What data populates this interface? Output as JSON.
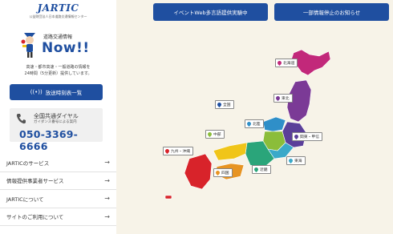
{
  "sidebar": {
    "logo": {
      "main": "JARTIC",
      "sub": "公益財団法人日本道路交通情報センター"
    },
    "hero": {
      "title": "道路交通情報",
      "brand": "Now!!"
    },
    "description": [
      "高速・都市高速・一般道路の情報を",
      "24時間（5分更新）提供しています。"
    ],
    "schedule_button": {
      "label": "放送時刻表一覧"
    },
    "phone": {
      "line1": "全国共通ダイヤル",
      "line2": "ガイダンス番号による案内",
      "number": "050-3369-6666"
    },
    "menu": [
      {
        "label": "JARTICのサービス"
      },
      {
        "label": "情報提供事業者サービス"
      },
      {
        "label": "JARTICについて"
      },
      {
        "label": "サイトのご利用について"
      }
    ]
  },
  "top_buttons": [
    {
      "label": "イベントWeb多言語提供実験中"
    },
    {
      "label": "一部情報停止のお知らせ"
    }
  ],
  "regions": [
    {
      "key": "hokkaido",
      "label": "北海道",
      "color": "#c2287a"
    },
    {
      "key": "tohoku",
      "label": "東北",
      "color": "#7b3a96"
    },
    {
      "key": "zenkoku",
      "label": "全国",
      "color": "#1f4fa0"
    },
    {
      "key": "hokuriku",
      "label": "北陸",
      "color": "#2f8fc8"
    },
    {
      "key": "chubu",
      "label": "中部",
      "color": "#8bbd3a"
    },
    {
      "key": "kanto",
      "label": "関東・甲信",
      "color": "#5b3f99"
    },
    {
      "key": "kinki",
      "label": "近畿",
      "color": "#2aa57a"
    },
    {
      "key": "tokai",
      "label": "東海",
      "color": "#3aa9c9"
    },
    {
      "key": "shikoku",
      "label": "四国",
      "color": "#e79423"
    },
    {
      "key": "kyushu",
      "label": "九州・沖縄",
      "color": "#d8232a"
    },
    {
      "key": "chugoku",
      "label": "中国",
      "color": "#f0c519"
    }
  ]
}
